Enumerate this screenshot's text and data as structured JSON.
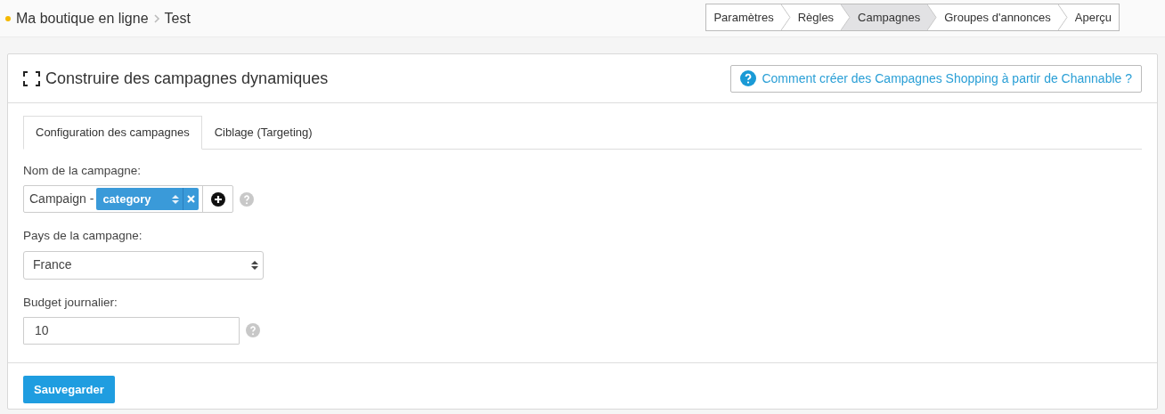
{
  "breadcrumb": {
    "parent": "Ma boutique en ligne",
    "current": "Test"
  },
  "steps": [
    {
      "label": "Paramètres",
      "selected": false
    },
    {
      "label": "Règles",
      "selected": false
    },
    {
      "label": "Campagnes",
      "selected": true
    },
    {
      "label": "Groupes d'annonces",
      "selected": false
    },
    {
      "label": "Aperçu",
      "selected": false
    }
  ],
  "card": {
    "title": "Construire des campagnes dynamiques",
    "help_link": "Comment créer des Campagnes Shopping à partir de Channable ?"
  },
  "tabs": [
    {
      "label": "Configuration des campagnes",
      "selected": true
    },
    {
      "label": "Ciblage (Targeting)",
      "selected": false
    }
  ],
  "campaign_name": {
    "label": "Nom de la campagne:",
    "prefix": "Campaign -",
    "token": "category"
  },
  "country": {
    "label": "Pays de la campagne:",
    "value": "France"
  },
  "budget": {
    "label": "Budget journalier:",
    "value": "10"
  },
  "save_button": "Sauvegarder"
}
